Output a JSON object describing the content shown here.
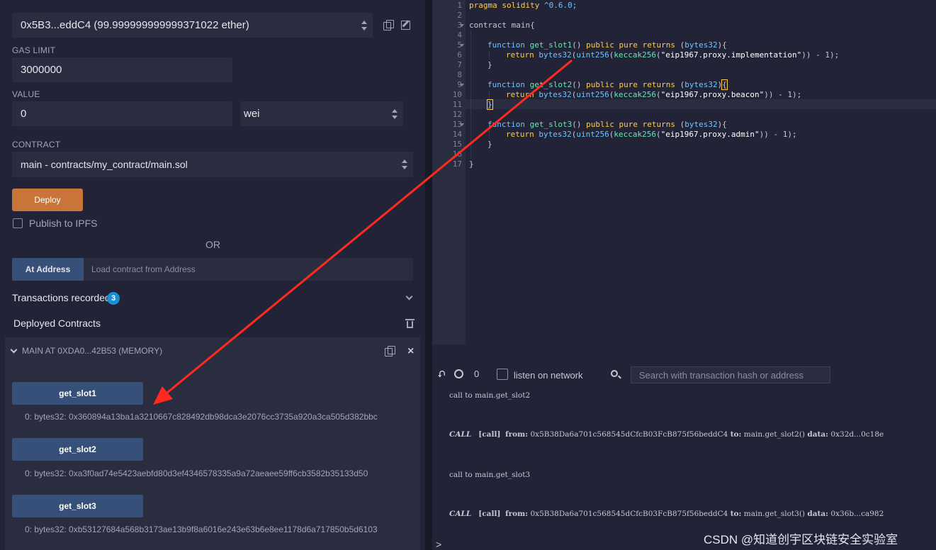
{
  "run_panel": {
    "account_value": "0x5B3...eddC4 (99.999999999999371022 ether)",
    "gas_limit_label": "GAS LIMIT",
    "gas_limit_value": "3000000",
    "value_label": "VALUE",
    "value_amount": "0",
    "value_unit": "wei",
    "contract_label": "CONTRACT",
    "contract_value": "main - contracts/my_contract/main.sol",
    "deploy_label": "Deploy",
    "publish_ipfs_label": "Publish to IPFS",
    "or_label": "OR",
    "at_address_label": "At Address",
    "at_address_placeholder": "Load contract from Address",
    "transactions_recorded_label": "Transactions recorded",
    "transactions_recorded_count": "3",
    "deployed_contracts_label": "Deployed Contracts"
  },
  "deployed_instance": {
    "header": "MAIN AT 0XDA0...42B53 (MEMORY)",
    "functions": [
      {
        "label": "get_slot1",
        "output": "0: bytes32: 0x360894a13ba1a3210667c828492db98dca3e2076cc3735a920a3ca505d382bbc"
      },
      {
        "label": "get_slot2",
        "output": "0: bytes32: 0xa3f0ad74e5423aebfd80d3ef4346578335a9a72aeaee59ff6cb3582b35133d50"
      },
      {
        "label": "get_slot3",
        "output": "0: bytes32: 0xb53127684a568b3173ae13b9f8a6016e243e63b6e8ee1178d6a717850b5d6103"
      }
    ]
  },
  "editor": {
    "line_numbers": [
      "1",
      "2",
      "3",
      "4",
      "5",
      "6",
      "7",
      "8",
      "9",
      "10",
      "11",
      "12",
      "13",
      "14",
      "15",
      "16",
      "17"
    ],
    "code": {
      "l1a": "pragma solidity ",
      "l1b": "^0.6.0;",
      "l3": "contract main{",
      "fn_kw": "function",
      "fn1": "get_slot1",
      "fn2": "get_slot2",
      "fn3": "get_slot3",
      "sig_paren": "() ",
      "public_kw": "public",
      "pure_kw": "pure",
      "returns_kw": "returns",
      "bytes32": "bytes32",
      "uint256": "uint256",
      "keccak": "keccak256",
      "return_kw": "return",
      "str1": "\"eip1967.proxy.implementation\"",
      "str2": "\"eip1967.proxy.beacon\"",
      "str3": "\"eip1967.proxy.admin\"",
      "minus_one": ")) - 1);",
      "close_brace": "}"
    }
  },
  "terminal": {
    "count": "0",
    "listen_label": "listen on network",
    "search_placeholder": "Search with transaction hash or address",
    "logs": [
      {
        "text": "call to main.get_slot2"
      },
      {
        "call": "CALL",
        "tag": "[call]",
        "from_label": "from:",
        "from": "0x5B38Da6a701c568545dCfcB03FcB875f56beddC4",
        "to_label": "to:",
        "to": "main.get_slot2()",
        "data_label": "data:",
        "data": "0x32d...0c18e"
      },
      {
        "text": "call to main.get_slot3"
      },
      {
        "call": "CALL",
        "tag": "[call]",
        "from_label": "from:",
        "from": "0x5B38Da6a701c568545dCfcB03FcB875f56beddC4",
        "to_label": "to:",
        "to": "main.get_slot3()",
        "data_label": "data:",
        "data": "0x36b...ca982"
      }
    ],
    "prompt": ">"
  },
  "watermark": "CSDN @知道创宇区块链安全实验室",
  "colors": {
    "background": "#222336",
    "panel": "#2a2c3f",
    "deploy_button": "#c97539",
    "function_button": "#36507a",
    "badge": "#1a8fd1",
    "annotation_arrow": "#ff2a1f"
  }
}
